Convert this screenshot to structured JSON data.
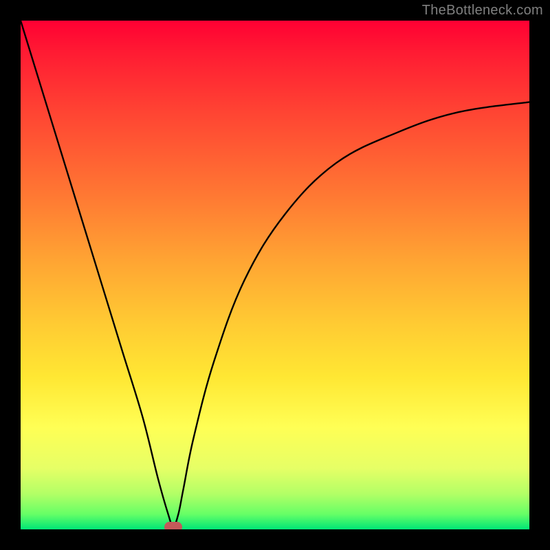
{
  "watermark": "TheBottleneck.com",
  "chart_data": {
    "type": "line",
    "title": "",
    "xlabel": "",
    "ylabel": "",
    "xlim": [
      0,
      100
    ],
    "ylim": [
      0,
      100
    ],
    "grid": false,
    "series": [
      {
        "name": "curve",
        "x": [
          0,
          4,
          8,
          12,
          16,
          20,
          24,
          27,
          29,
          30,
          31,
          32,
          34,
          38,
          44,
          52,
          62,
          74,
          86,
          100
        ],
        "y": [
          100,
          87,
          74,
          61,
          48,
          35,
          22,
          10,
          3,
          0.5,
          3,
          8,
          18,
          33,
          49,
          62,
          72,
          78,
          82,
          84
        ]
      }
    ],
    "minimum_marker": {
      "x": 30,
      "y": 0.5
    },
    "gradient_stops": [
      {
        "pos": 0,
        "color": "#ff0033"
      },
      {
        "pos": 50,
        "color": "#ffaa33"
      },
      {
        "pos": 80,
        "color": "#ffff55"
      },
      {
        "pos": 100,
        "color": "#00e676"
      }
    ]
  }
}
